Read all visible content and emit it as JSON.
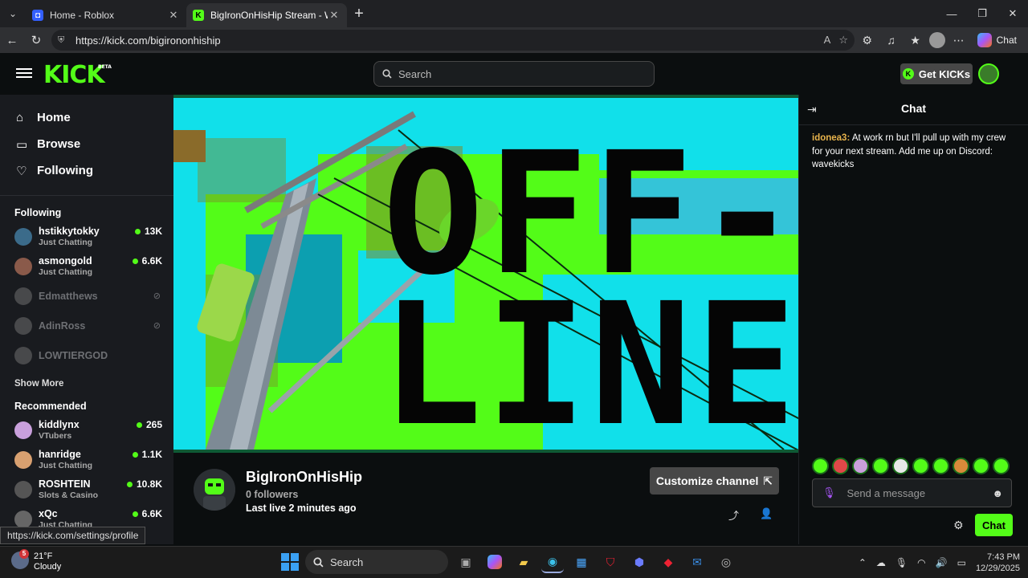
{
  "browser": {
    "tabs": [
      {
        "title": "Home - Roblox",
        "active": false
      },
      {
        "title": "BigIronOnHisHip Stream - Watch Live on Kick",
        "active": true
      }
    ],
    "url": "https://kick.com/bigirononhiship",
    "chat_button": "Chat"
  },
  "header": {
    "logo": "KICK",
    "logo_badge": "BETA",
    "search_placeholder": "Search",
    "get_kicks": "Get KICKs"
  },
  "sidebar": {
    "nav": [
      {
        "label": "Home",
        "icon": "home-icon"
      },
      {
        "label": "Browse",
        "icon": "browse-icon"
      },
      {
        "label": "Following",
        "icon": "heart-icon"
      }
    ],
    "following_header": "Following",
    "following": [
      {
        "name": "hstikkytokky",
        "category": "Just Chatting",
        "viewers": "13K",
        "live": true,
        "color": "#3b6b8a"
      },
      {
        "name": "asmongold",
        "category": "Just Chatting",
        "viewers": "6.6K",
        "live": true,
        "color": "#8a5a4a"
      },
      {
        "name": "Edmatthews",
        "category": "",
        "viewers": "",
        "live": false,
        "color": "#777"
      },
      {
        "name": "AdinRoss",
        "category": "",
        "viewers": "",
        "live": false,
        "color": "#777"
      },
      {
        "name": "LOWTIERGOD",
        "category": "",
        "viewers": "",
        "live": false,
        "color": "#777"
      }
    ],
    "show_more": "Show More",
    "recommended_header": "Recommended",
    "recommended": [
      {
        "name": "kiddlynx",
        "category": "VTubers",
        "viewers": "265",
        "color": "#c9a0dc"
      },
      {
        "name": "hanridge",
        "category": "Just Chatting",
        "viewers": "1.1K",
        "color": "#d8a070"
      },
      {
        "name": "ROSHTEIN",
        "category": "Slots & Casino",
        "viewers": "10.8K",
        "color": "#555"
      },
      {
        "name": "xQc",
        "category": "Just Chatting",
        "viewers": "6.6K",
        "color": "#666"
      }
    ]
  },
  "video": {
    "offline_line1": "OFF-",
    "offline_line2": "LINE"
  },
  "channel": {
    "name": "BigIronOnHisHip",
    "followers": "0 followers",
    "last_live": "Last live 2 minutes ago",
    "customize": "Customize channel"
  },
  "chat": {
    "title": "Chat",
    "messages": [
      {
        "user": "idonea3:",
        "text": "At work rn but I'll pull up with my crew for your next stream. Add me up on Discord:  wavekicks"
      }
    ],
    "input_placeholder": "Send a message",
    "send": "Chat"
  },
  "status_url": "https://kick.com/settings/profile",
  "taskbar": {
    "weather_temp": "21°F",
    "weather_desc": "Cloudy",
    "weather_badge": "5",
    "search": "Search",
    "time": "7:43 PM",
    "date": "12/29/2025"
  }
}
